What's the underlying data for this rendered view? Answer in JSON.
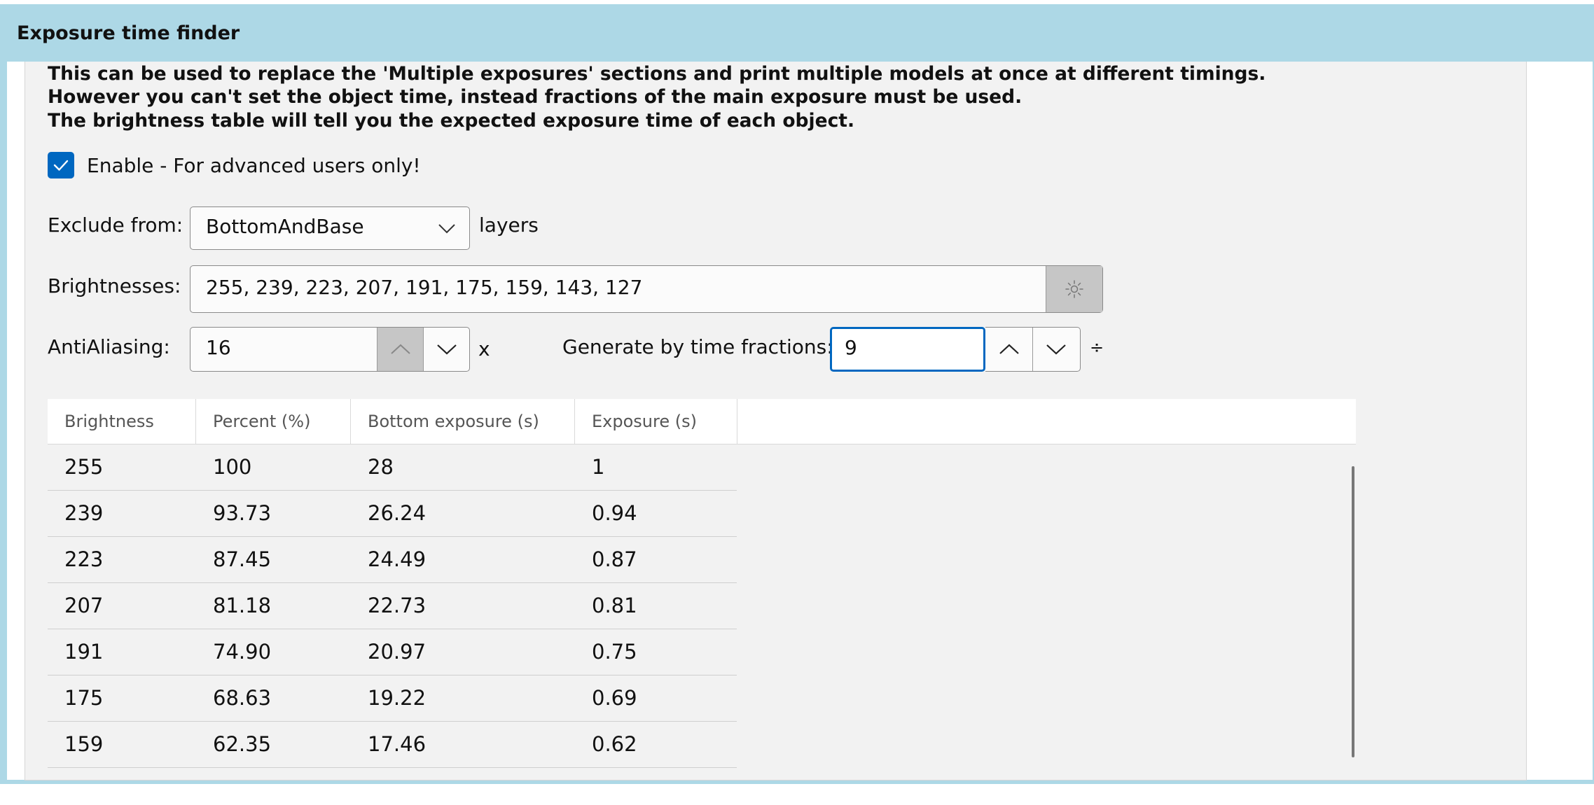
{
  "window": {
    "title": "Exposure time finder"
  },
  "description": [
    "This can be used to replace the 'Multiple exposures' sections and print multiple models at once at different timings.",
    "However you can't set the object time, instead fractions of the main exposure must be used.",
    "The brightness table will tell you the expected exposure time of each object."
  ],
  "enable": {
    "label": "Enable - For advanced users only!",
    "checked": true
  },
  "exclude": {
    "label": "Exclude from:",
    "value": "BottomAndBase",
    "suffix": "layers"
  },
  "brightnesses": {
    "label": "Brightnesses:",
    "value": "255, 239, 223, 207, 191, 175, 159, 143, 127",
    "button_icon": "sun-icon"
  },
  "antialiasing": {
    "label": "AntiAliasing:",
    "value": "16",
    "suffix": "x"
  },
  "fractions": {
    "label": "Generate by time fractions:",
    "value": "9",
    "suffix": "÷"
  },
  "table": {
    "columns": [
      "Brightness",
      "Percent (%)",
      "Bottom exposure (s)",
      "Exposure (s)"
    ],
    "rows": [
      [
        "255",
        "100",
        "28",
        "1"
      ],
      [
        "239",
        "93.73",
        "26.24",
        "0.94"
      ],
      [
        "223",
        "87.45",
        "24.49",
        "0.87"
      ],
      [
        "207",
        "81.18",
        "22.73",
        "0.81"
      ],
      [
        "191",
        "74.90",
        "20.97",
        "0.75"
      ],
      [
        "175",
        "68.63",
        "19.22",
        "0.69"
      ],
      [
        "159",
        "62.35",
        "17.46",
        "0.62"
      ]
    ]
  },
  "colors": {
    "frame": "#add8e6",
    "accent": "#0067c0",
    "panel": "#f2f2f2"
  }
}
